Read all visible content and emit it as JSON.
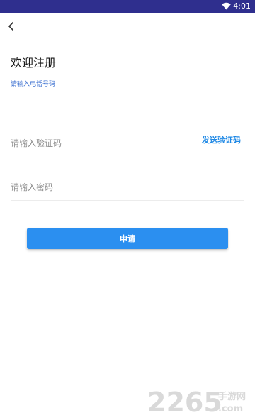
{
  "status_bar": {
    "time": "4:01",
    "bg_color": "#2f2f8e"
  },
  "page": {
    "title": "欢迎注册"
  },
  "phone_field": {
    "label": "请输入电话号码",
    "value": "",
    "placeholder": ""
  },
  "code_field": {
    "value": "",
    "placeholder": "请输入验证码",
    "send_label": "发送验证码"
  },
  "password_field": {
    "value": "",
    "placeholder": "请输入密码"
  },
  "submit": {
    "label": "申请",
    "color": "#2b8ff0"
  },
  "watermark": {
    "number": "2265",
    "name": "手游网",
    "domain": ".com"
  }
}
